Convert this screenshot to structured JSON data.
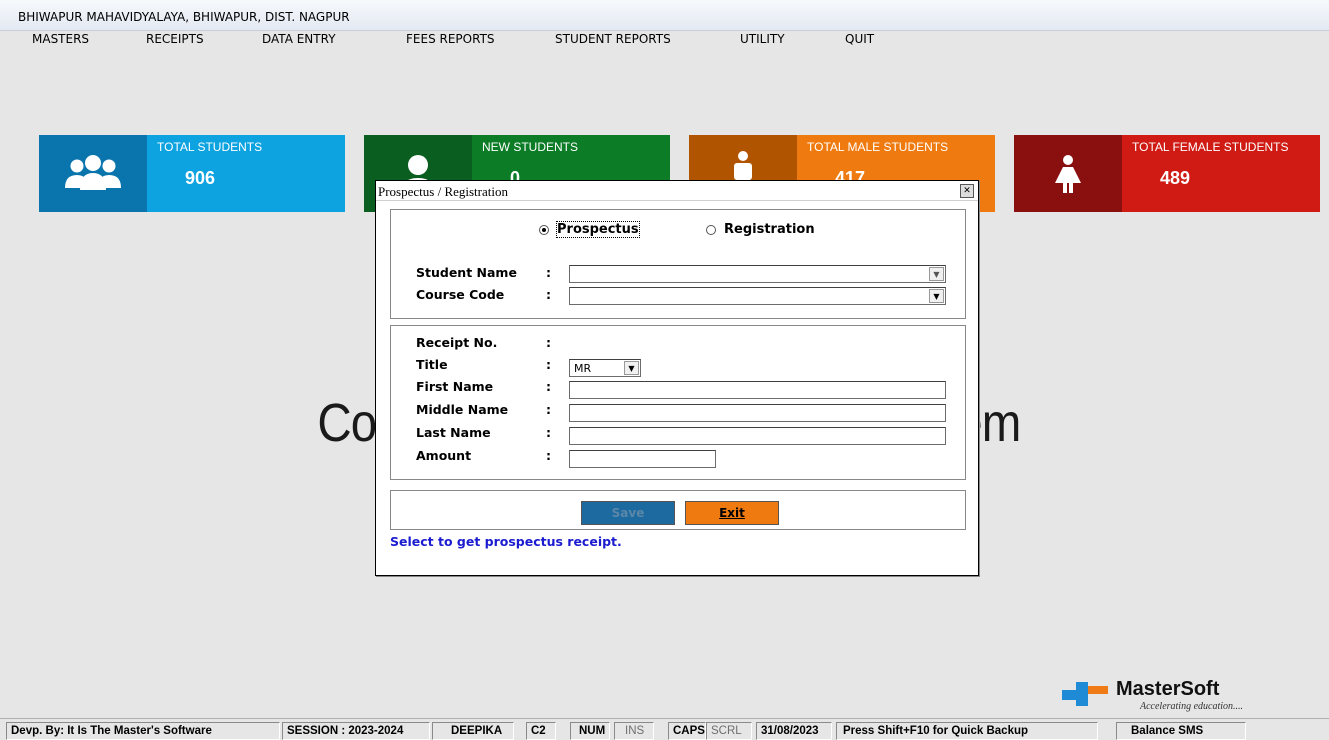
{
  "app_title": "BHIWAPUR MAHAVIDYALAYA, BHIWAPUR, DIST. NAGPUR",
  "menu": [
    "MASTERS",
    "RECEIPTS",
    "DATA ENTRY",
    "FEES REPORTS",
    "STUDENT REPORTS",
    "UTILITY",
    "QUIT"
  ],
  "cards": [
    {
      "label": "TOTAL STUDENTS",
      "value": "906",
      "icon": "users-group-icon",
      "icon_color": "#0a75ad",
      "body_color": "#0da2e0"
    },
    {
      "label": "NEW STUDENTS",
      "value": "0",
      "icon": "user-icon",
      "icon_color": "#0a5e1f",
      "body_color": "#0c7c27"
    },
    {
      "label": "TOTAL MALE STUDENTS",
      "value": "417",
      "icon": "male-icon",
      "icon_color": "#b05400",
      "body_color": "#ef7b10"
    },
    {
      "label": "TOTAL FEMALE STUDENTS",
      "value": "489",
      "icon": "female-icon",
      "icon_color": "#8a0f0f",
      "body_color": "#cf1b13"
    }
  ],
  "background_title": "Coll                                tem",
  "dialog": {
    "title": "Prospectus / Registration",
    "radio_prospectus": "Prospectus",
    "radio_registration": "Registration",
    "selected": "Prospectus",
    "student_name_label": "Student Name",
    "course_code_label": "Course Code",
    "receipt_no_label": "Receipt No.",
    "title_label": "Title",
    "title_value": "MR",
    "first_name_label": "First Name",
    "middle_name_label": "Middle Name",
    "last_name_label": "Last Name",
    "amount_label": "Amount",
    "colon": ":",
    "save_label": "Save",
    "exit_label": "Exit",
    "hint": "Select to get prospectus receipt."
  },
  "logo": {
    "name": "MasterSoft",
    "tagline": "Accelerating education...."
  },
  "status": [
    "Devp. By: It Is The Master's Software",
    "SESSION : 2023-2024",
    "DEEPIKA",
    "C2",
    "NUM",
    "INS",
    "CAPS",
    "SCRL",
    "31/08/2023",
    "Press Shift+F10 for Quick Backup",
    "Balance SMS"
  ]
}
